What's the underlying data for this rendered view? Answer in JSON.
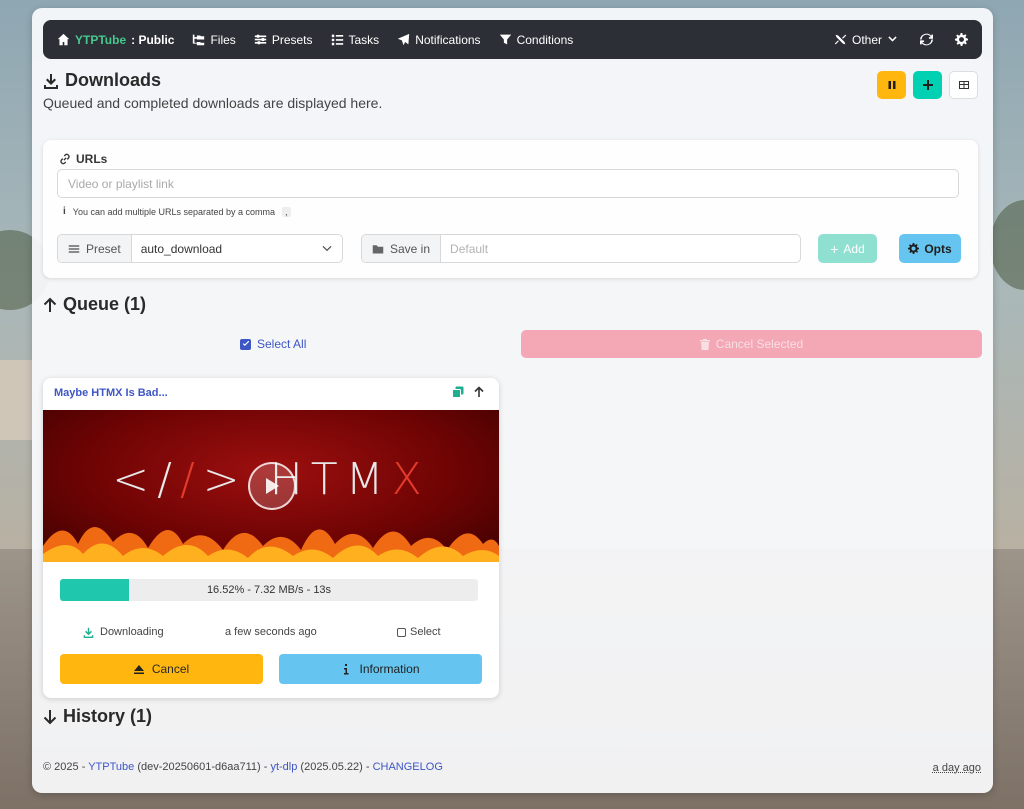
{
  "nav": {
    "brand_name": "YTPTube",
    "brand_suffix": ": Public",
    "items": [
      "Files",
      "Presets",
      "Tasks",
      "Notifications",
      "Conditions"
    ],
    "other_label": "Other"
  },
  "header": {
    "title": "Downloads",
    "subtitle": "Queued and completed downloads are displayed here."
  },
  "form": {
    "urls_label": "URLs",
    "url_placeholder": "Video or playlist link",
    "hint": "You can add multiple URLs separated by a comma",
    "hint_sep": ",",
    "preset_label": "Preset",
    "preset_value": "auto_download",
    "save_in_label": "Save in",
    "save_in_placeholder": "Default",
    "add_label": "Add",
    "opts_label": "Opts"
  },
  "queue": {
    "title": "Queue (1)",
    "select_all": "Select All",
    "cancel_selected": "Cancel Selected",
    "items": [
      {
        "title": "Maybe HTMX Is Bad...",
        "thumb_text_a": "</",
        "thumb_text_b": ">",
        "thumb_brand": "HTM",
        "thumb_brand_x": "X",
        "progress": 0.1652,
        "progress_text": "16.52% - 7.32 MB/s - 13s",
        "status": "Downloading",
        "time": "a few seconds ago",
        "select_label": "Select",
        "cancel_label": "Cancel",
        "info_label": "Information"
      }
    ]
  },
  "history": {
    "title": "History (1)"
  },
  "footer": {
    "copyright": "© 2025 - ",
    "app_link": "YTPTube",
    "version": " (dev-20250601-d6aa711) - ",
    "ytdlp_link": "yt-dlp",
    "ytdlp_version": " (2025.05.22) - ",
    "changelog_link": "CHANGELOG",
    "updated": "a day ago"
  },
  "colors": {
    "accent_green": "#48c78e",
    "warning": "#ffb70f",
    "primary_teal": "#00d1b2",
    "info": "#66c5f0",
    "danger_light": "#f4a7b4",
    "link": "#3e56c4"
  }
}
